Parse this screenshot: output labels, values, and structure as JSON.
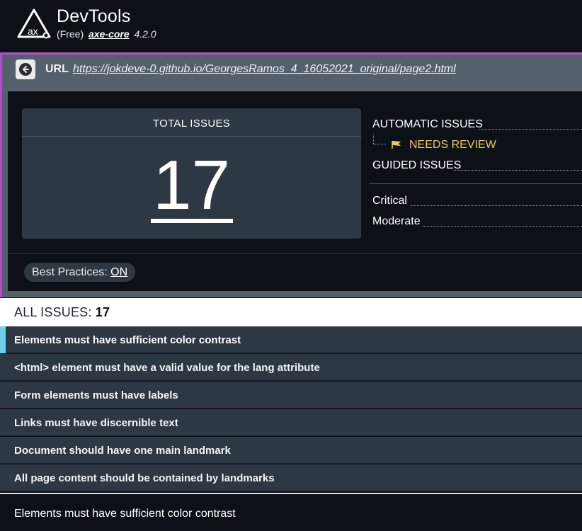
{
  "header": {
    "title": "DevTools",
    "sub_paren": "(Free)",
    "sub_core": "axe-core",
    "sub_version": "4.2.0",
    "logo_text": "ax"
  },
  "url_bar": {
    "label": "URL",
    "url": "https://jokdeve-0.github.io/GeorgesRamos_4_16052021_original/page2.html"
  },
  "summary": {
    "total_label": "TOTAL ISSUES",
    "total_value": "17",
    "automatic_label": "AUTOMATIC ISSUES",
    "needs_review_label": "NEEDS REVIEW",
    "guided_label": "GUIDED ISSUES",
    "critical_label": "Critical",
    "moderate_label": "Moderate",
    "best_practices_label": "Best Practices:",
    "best_practices_value": "ON"
  },
  "all_issues": {
    "label": "ALL ISSUES:",
    "count": "17"
  },
  "issues": [
    "Elements must have sufficient color contrast",
    "<html> element must have a valid value for the lang attribute",
    "Form elements must have labels",
    "Links must have discernible text",
    "Document should have one main landmark",
    "All page content should be contained by landmarks"
  ],
  "detail": {
    "title": "Elements must have sufficient color contrast"
  },
  "colors": {
    "accent_magenta": "#b64bd1",
    "accent_cyan": "#6fd1ec",
    "needs_review": "#f2c761",
    "panel": "#2e3843",
    "background": "#0c1118"
  }
}
